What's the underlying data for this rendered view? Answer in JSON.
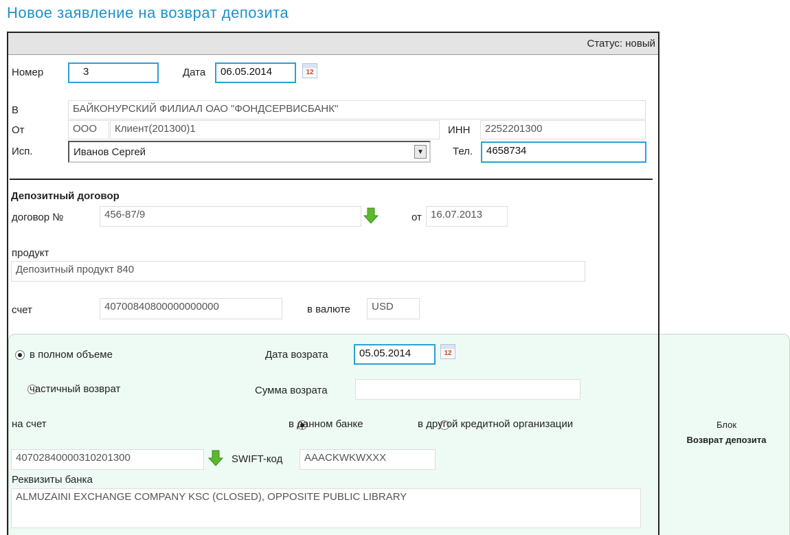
{
  "page_title": "Новое заявление на возврат депозита",
  "status": "Статус: новый",
  "header": {
    "number_label": "Номер",
    "number_value": "3",
    "date_label": "Дата",
    "date_value": "06.05.2014",
    "to_label": "В",
    "to_value": "БАЙКОНУРСКИЙ ФИЛИАЛ ОАО \"ФОНДСЕРВИСБАНК\"",
    "from_label": "От",
    "from_org_type": "ООО",
    "from_client": "Клиент(201300)1",
    "inn_label": "ИНН",
    "inn_value": "2252201300",
    "exec_label": "Исп.",
    "exec_value": "Иванов Сергей",
    "phone_label": "Тел.",
    "phone_value": "4658734"
  },
  "deposit": {
    "section_title": "Депозитный договор",
    "contract_label": "договор №",
    "contract_value": "456-87/9",
    "contract_date_label": "от",
    "contract_date_value": "16.07.2013",
    "product_label": "продукт",
    "product_value": "Депозитный продукт 840",
    "account_label": "счет",
    "account_value": "40700840800000000000",
    "currency_label": "в валюте",
    "currency_value": "USD"
  },
  "refund": {
    "full_label": "в полном объеме",
    "full_selected": true,
    "refund_date_label": "Дата возрата",
    "refund_date_value": "05.05.2014",
    "partial_label": "частичный возврат",
    "partial_selected": false,
    "amount_label": "Сумма возрата",
    "amount_value": "",
    "to_account_label": "на счет",
    "this_bank_label": "в данном банке",
    "this_bank_selected": true,
    "other_bank_label": "в другой кредитной организации",
    "other_bank_selected": false,
    "target_account_value": "40702840000310201300",
    "swift_label": "SWIFT-код",
    "swift_value": "AAACKWKWXXX",
    "bank_details_label": "Реквизиты банка",
    "bank_details_value": "ALMUZAINI EXCHANGE COMPANY KSC (CLOSED), OPPOSITE PUBLIC LIBRARY"
  },
  "annotation": {
    "line1": "Блок",
    "line2": "Возврат депозита"
  },
  "icons": {
    "calendar": "calendar-icon",
    "arrow": "green-down-arrow-icon",
    "calendar_day": "12"
  },
  "colors": {
    "title": "#1e90c8",
    "focus_border": "#2a9fd6",
    "panel_bg": "#eefbf4",
    "arrow_green": "#5cb82d"
  }
}
